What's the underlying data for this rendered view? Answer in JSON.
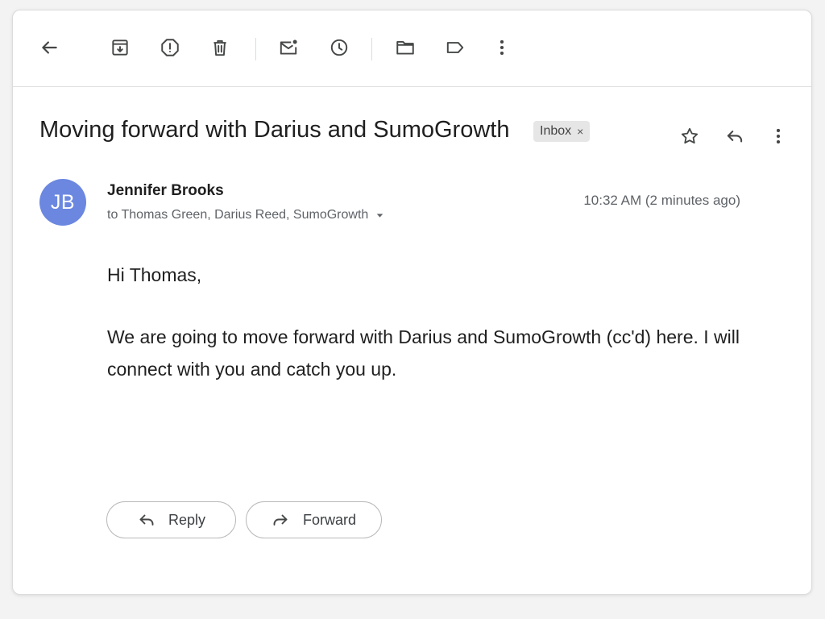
{
  "toolbar": {
    "icons": [
      "back-arrow-icon",
      "archive-icon",
      "report-spam-icon",
      "delete-icon",
      "mark-unread-icon",
      "snooze-icon",
      "move-to-folder-icon",
      "label-icon",
      "more-vert-icon"
    ]
  },
  "message": {
    "subject": "Moving forward with Darius and SumoGrowth",
    "label": "Inbox",
    "label_remove": "×",
    "sender": {
      "name": "Jennifer Brooks",
      "initials": "JB",
      "avatar_color": "#6b87e0"
    },
    "recipients": "to Thomas Green, Darius Reed, SumoGrowth",
    "timestamp": "10:32 AM (2 minutes ago)",
    "body": [
      "Hi Thomas,",
      "We are going to move forward with Darius and SumoGrowth (cc'd) here. I will connect with you and catch you up."
    ]
  },
  "actions": {
    "reply_label": "Reply",
    "forward_label": "Forward"
  },
  "colors": {
    "text": "#1f1f1f",
    "muted": "#5f6368",
    "icon": "#444746",
    "chip_bg": "#e6e6e6"
  }
}
